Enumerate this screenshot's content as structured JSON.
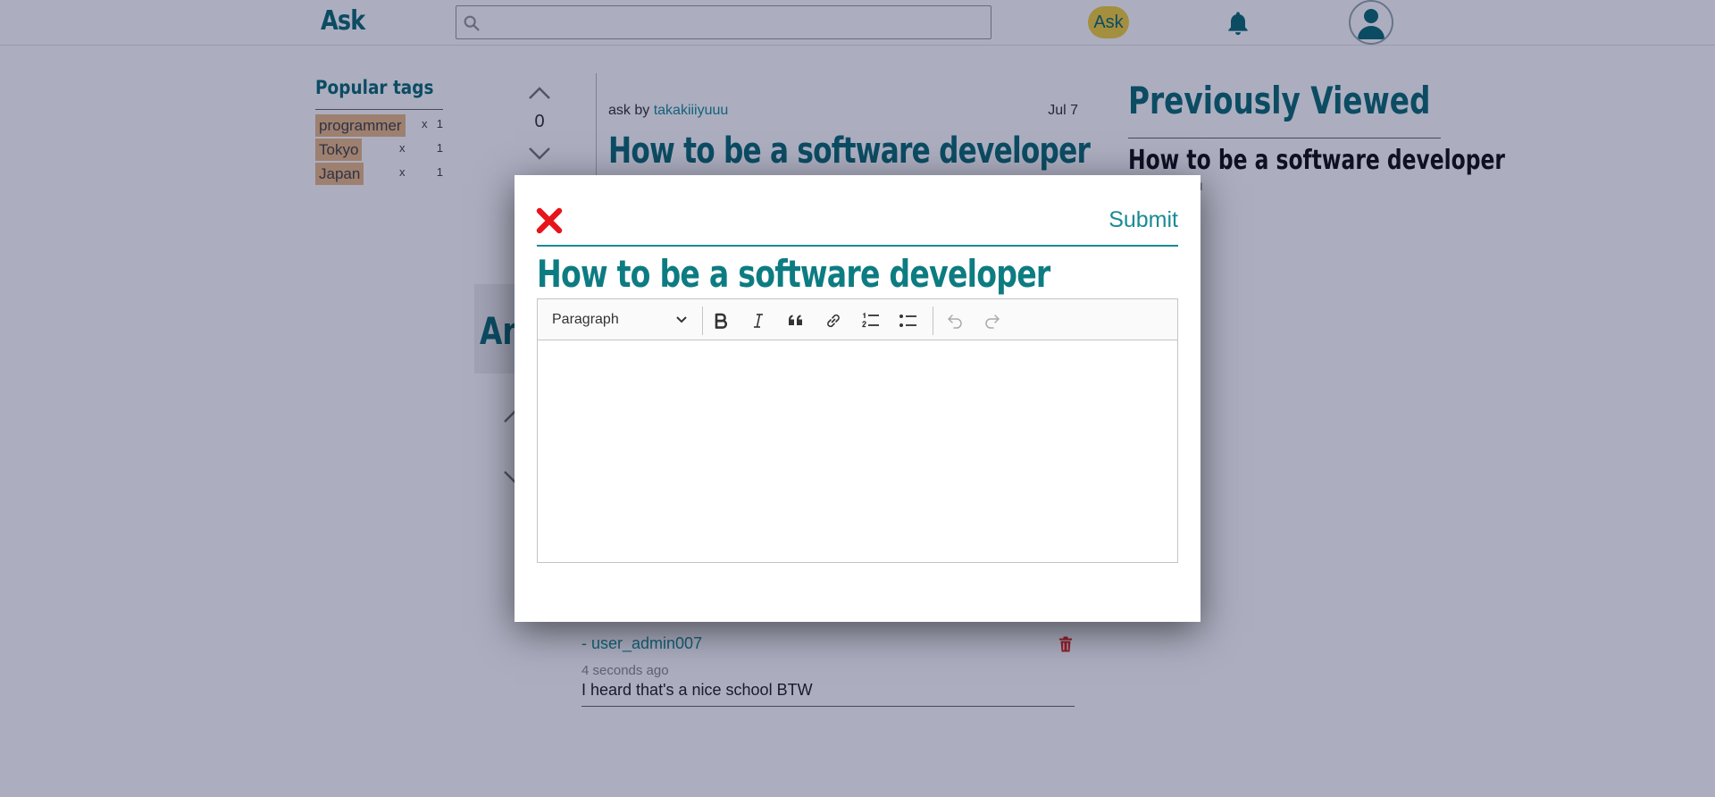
{
  "header": {
    "logo": "Ask",
    "search_placeholder": "",
    "ask_button": "Ask"
  },
  "sidebar": {
    "title": "Popular tags",
    "tags": [
      {
        "name": "programmer",
        "x": "x",
        "count": "1"
      },
      {
        "name": "Tokyo",
        "x": "x",
        "count": "1"
      },
      {
        "name": "Japan",
        "x": "x",
        "count": "1"
      }
    ]
  },
  "question": {
    "votes": "0",
    "ask_by_prefix": "ask by",
    "author": "takakiiiyuuu",
    "date": "Jul 7",
    "title": "How to be a software developer"
  },
  "answers": {
    "heading": "Answers",
    "comment": {
      "user": "- user_admin007",
      "time": "4 seconds ago",
      "text": "I heard that's a nice school BTW"
    }
  },
  "previously_viewed": {
    "title": "Previously Viewed",
    "item_title": "How to be a software developer",
    "item_author": "takakiiiyuuu"
  },
  "modal": {
    "submit_label": "Submit",
    "title": "How to be a software developer",
    "editor": {
      "block_format": "Paragraph",
      "tools": [
        "bold-icon",
        "italic-icon",
        "blockquote-icon",
        "link-icon",
        "numbered-list-icon",
        "bulleted-list-icon",
        "undo-icon",
        "redo-icon"
      ]
    }
  },
  "colors": {
    "brand": "#0d6b72",
    "link": "#1a8b93",
    "ask_button": "#f2d13b",
    "tag_chip": "#e8b984",
    "close_x": "#e8141b",
    "delete": "#d9281e"
  }
}
